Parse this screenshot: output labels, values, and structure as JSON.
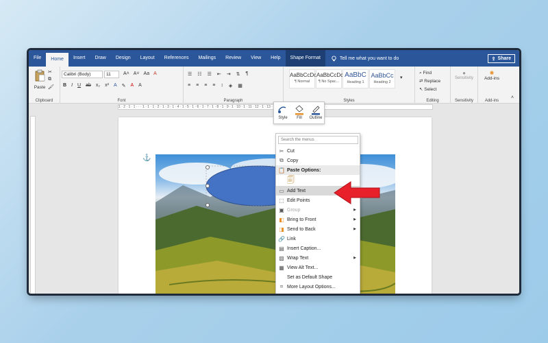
{
  "tabs": [
    "File",
    "Home",
    "Insert",
    "Draw",
    "Design",
    "Layout",
    "References",
    "Mailings",
    "Review",
    "View",
    "Help",
    "Shape Format"
  ],
  "active_tab": "Home",
  "tell_me": "Tell me what you want to do",
  "share_label": "Share",
  "ribbon": {
    "clipboard": {
      "label": "Clipboard",
      "paste": "Paste"
    },
    "font": {
      "label": "Font",
      "name": "Calibri (Body)",
      "size": "11"
    },
    "paragraph": {
      "label": "Paragraph"
    },
    "styles": {
      "label": "Styles",
      "tiles": [
        {
          "preview": "AaBbCcDc",
          "name": "¶ Normal"
        },
        {
          "preview": "AaBbCcDc",
          "name": "¶ No Spac..."
        },
        {
          "preview": "AaBbC",
          "name": "Heading 1"
        },
        {
          "preview": "AaBbCc",
          "name": "Heading 2"
        }
      ]
    },
    "editing": {
      "label": "Editing",
      "find": "Find",
      "replace": "Replace",
      "select": "Select"
    },
    "sensitivity": {
      "label": "Sensitivity",
      "button": "Sensitivity"
    },
    "addins": {
      "label": "Add-ins",
      "button": "Add-ins"
    }
  },
  "ruler_text": "1 · 2 · 1 · 1 · · · 1 · 1 · 1 · 2 · 1 · 3 · 1 · 4 · 1 · 5 · 1 · 6 · 1 · 7 · 1 · 8 · 1 · 9 · 1 · 10 · 1 · 11 · 12 · 1 · 13 · 1 · 14 · 1 · 15 · 1 · 16 · 17 · 1 · 18 ·",
  "mini_toolbar": [
    "Style",
    "Fill",
    "Outline"
  ],
  "context_menu": {
    "search_placeholder": "Search the menus",
    "items": [
      {
        "label": "Cut",
        "icon": "scissors-icon",
        "state": "normal"
      },
      {
        "label": "Copy",
        "icon": "copy-icon",
        "state": "normal"
      },
      {
        "label": "Paste Options:",
        "icon": "paste-icon",
        "state": "header"
      },
      {
        "label": "",
        "icon": "paste-option-icon",
        "state": "icon-row"
      },
      {
        "label": "Add Text",
        "icon": "textbox-icon",
        "state": "highlight"
      },
      {
        "label": "Edit Points",
        "icon": "edit-points-icon",
        "state": "normal"
      },
      {
        "label": "Group",
        "icon": "group-icon",
        "state": "disabled",
        "submenu": true
      },
      {
        "label": "Bring to Front",
        "icon": "bring-front-icon",
        "state": "normal",
        "submenu": true
      },
      {
        "label": "Send to Back",
        "icon": "send-back-icon",
        "state": "normal",
        "submenu": true
      },
      {
        "label": "Link",
        "icon": "link-icon",
        "state": "normal"
      },
      {
        "label": "Insert Caption...",
        "icon": "caption-icon",
        "state": "normal"
      },
      {
        "label": "Wrap Text",
        "icon": "wrap-text-icon",
        "state": "normal",
        "submenu": true
      },
      {
        "label": "View Alt Text...",
        "icon": "alt-text-icon",
        "state": "normal"
      },
      {
        "label": "Set as Default Shape",
        "icon": "",
        "state": "normal"
      },
      {
        "label": "More Layout Options...",
        "icon": "layout-options-icon",
        "state": "normal"
      }
    ]
  },
  "colors": {
    "accent": "#2b579a",
    "shape_fill": "#4472c4",
    "arrow": "#e8202a"
  }
}
